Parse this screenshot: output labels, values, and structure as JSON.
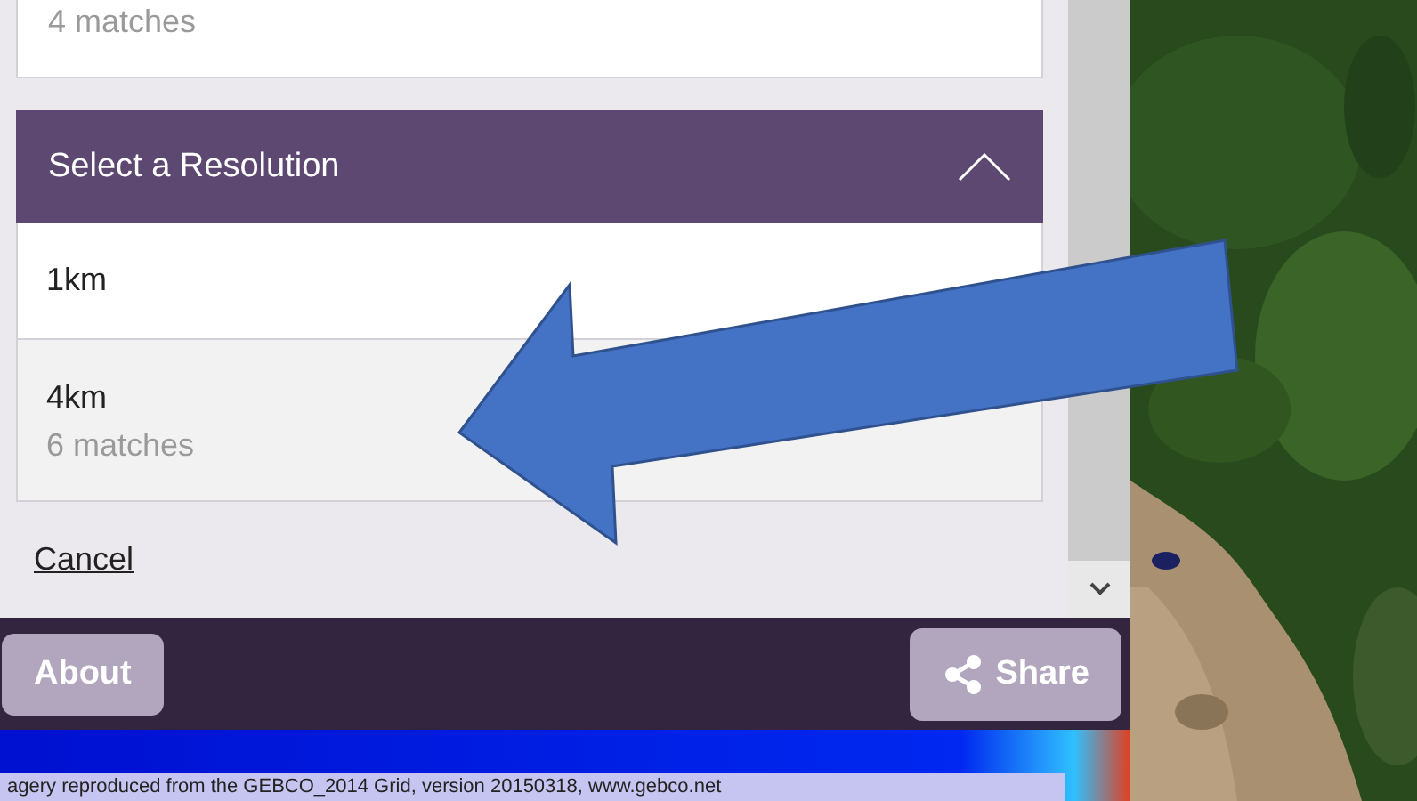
{
  "previous_card": {
    "subtitle": "4 matches"
  },
  "resolution_panel": {
    "title": "Select a Resolution",
    "expanded": true,
    "options": [
      {
        "label": "1km",
        "selected": false
      },
      {
        "label": "4km",
        "subtitle": "6 matches",
        "selected": true
      }
    ]
  },
  "cancel_link": "Cancel",
  "footer": {
    "buttons": [
      {
        "label": "About",
        "kind": "plain"
      },
      {
        "label": "Share",
        "kind": "share"
      }
    ]
  },
  "attribution": "agery reproduced from the GEBCO_2014 Grid, version 20150318, www.gebco.net"
}
